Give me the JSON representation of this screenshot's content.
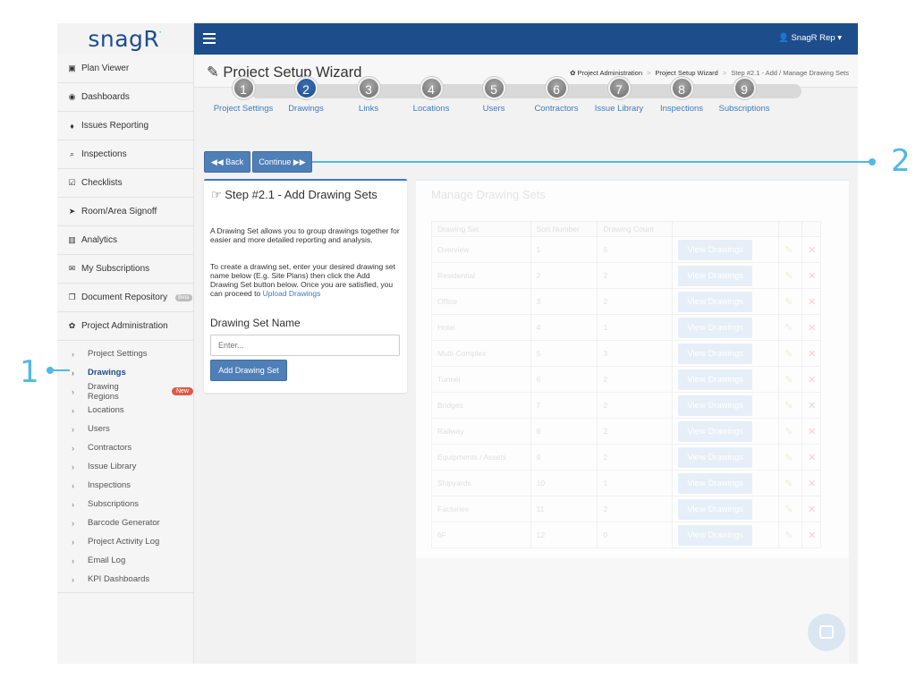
{
  "app": {
    "logo_text": "snagR",
    "logo_mark": "·"
  },
  "topbar": {
    "user_label": "SnagR Rep ▾"
  },
  "sidebar": {
    "items": [
      {
        "icon": "image-icon",
        "glyph": "▣",
        "label": "Plan Viewer"
      },
      {
        "icon": "dashboard-icon",
        "glyph": "◉",
        "label": "Dashboards"
      },
      {
        "icon": "pin-icon",
        "glyph": "♦",
        "label": "Issues Reporting"
      },
      {
        "icon": "search-icon",
        "glyph": "⌕",
        "label": "Inspections"
      },
      {
        "icon": "checkbox-icon",
        "glyph": "☑",
        "label": "Checklists"
      },
      {
        "icon": "location-arrow-icon",
        "glyph": "➤",
        "label": "Room/Area Signoff"
      },
      {
        "icon": "bar-chart-icon",
        "glyph": "▥",
        "label": "Analytics"
      },
      {
        "icon": "envelope-icon",
        "glyph": "✉",
        "label": "My Subscriptions"
      },
      {
        "icon": "documents-icon",
        "glyph": "❐",
        "label": "Document Repository",
        "badge": "Beta"
      },
      {
        "icon": "gears-icon",
        "glyph": "✿",
        "label": "Project Administration"
      }
    ],
    "sub_items": [
      {
        "label": "Project Settings"
      },
      {
        "label": "Drawings",
        "active": true
      },
      {
        "label": "Drawing Regions",
        "badge": "New"
      },
      {
        "label": "Locations"
      },
      {
        "label": "Users"
      },
      {
        "label": "Contractors"
      },
      {
        "label": "Issue Library"
      },
      {
        "label": "Inspections"
      },
      {
        "label": "Subscriptions"
      },
      {
        "label": "Barcode Generator"
      },
      {
        "label": "Project Activity Log"
      },
      {
        "label": "Email Log"
      },
      {
        "label": "KPI Dashboards"
      }
    ]
  },
  "header": {
    "title": "Project Setup Wizard",
    "title_icon": "magic-wand-icon",
    "breadcrumb": [
      "Project Administration",
      "Project Setup Wizard",
      "Step #2.1 - Add / Manage Drawing Sets"
    ]
  },
  "wizard": {
    "steps": [
      {
        "num": "1",
        "label": "Project Settings"
      },
      {
        "num": "2",
        "label": "Drawings",
        "active": true
      },
      {
        "num": "3",
        "label": "Links"
      },
      {
        "num": "4",
        "label": "Locations"
      },
      {
        "num": "5",
        "label": "Users"
      },
      {
        "num": "6",
        "label": "Contractors"
      },
      {
        "num": "7",
        "label": "Issue Library"
      },
      {
        "num": "8",
        "label": "Inspections"
      },
      {
        "num": "9",
        "label": "Subscriptions"
      }
    ],
    "back_label": "◀◀ Back",
    "continue_label": "Continue ▶▶"
  },
  "callouts": {
    "one": "1",
    "two": "2"
  },
  "add_panel": {
    "title": "☞ Step #2.1 - Add Drawing Sets",
    "para1": "A Drawing Set allows you to group drawings together for easier and more detailed reporting and analysis.",
    "para2_pre": "To create a drawing set, enter your desired drawing set name below (E.g. Site Plans) then click the Add Drawing Set button below. Once you are satisfied, you can proceed to ",
    "para2_link": "Upload Drawings",
    "field_label": "Drawing Set Name",
    "placeholder": "Enter...",
    "add_button": "Add Drawing Set"
  },
  "manage_panel": {
    "title": "Manage Drawing Sets",
    "columns": [
      "Drawing Set",
      "Sort Number",
      "Drawing Count",
      "",
      "",
      ""
    ],
    "view_label": "View Drawings",
    "rows": [
      {
        "name": "Overview",
        "sort": "1",
        "count": "6"
      },
      {
        "name": "Residential",
        "sort": "2",
        "count": "2"
      },
      {
        "name": "Office",
        "sort": "3",
        "count": "2"
      },
      {
        "name": "Hotel",
        "sort": "4",
        "count": "1"
      },
      {
        "name": "Multi-Complex",
        "sort": "5",
        "count": "3"
      },
      {
        "name": "Tunnel",
        "sort": "6",
        "count": "2"
      },
      {
        "name": "Bridges",
        "sort": "7",
        "count": "2"
      },
      {
        "name": "Railway",
        "sort": "8",
        "count": "2"
      },
      {
        "name": "Equipments / Assets",
        "sort": "9",
        "count": "2"
      },
      {
        "name": "Shipyards",
        "sort": "10",
        "count": "1"
      },
      {
        "name": "Factories",
        "sort": "11",
        "count": "2"
      },
      {
        "name": "6F",
        "sort": "12",
        "count": "0"
      }
    ]
  }
}
